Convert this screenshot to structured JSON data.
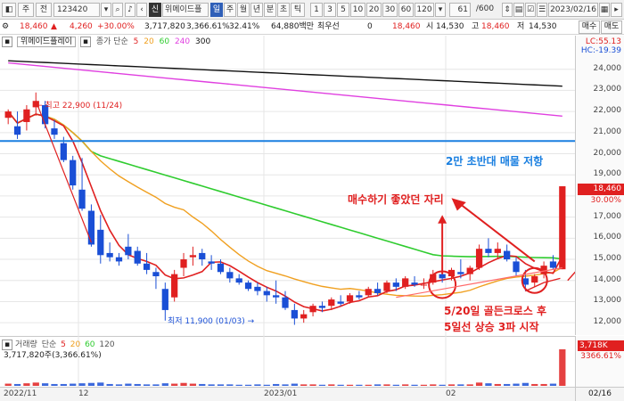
{
  "toolbar": {
    "code_label": "주",
    "prev_label": "전",
    "stock_code": "123420",
    "stock_name": "위메이드플",
    "period_tabs": [
      "일",
      "주",
      "월",
      "년",
      "분",
      "초",
      "틱"
    ],
    "interval_buttons": [
      "1",
      "3",
      "5",
      "10",
      "20",
      "30",
      "60",
      "120"
    ],
    "count_value": "61",
    "count_total": "/600",
    "date_value": "2023/02/16",
    "buy_label": "매수",
    "sell_label": "매도"
  },
  "quote": {
    "price": "18,460",
    "change": "4,260",
    "change_pct": "+30.00%",
    "volume": "3,717,820",
    "volume_ratio": "3,366.61%",
    "turnover": "32.41%",
    "amount": "64,880백만",
    "priority_label": "최우선",
    "priority_value": "0",
    "last_price": "18,460",
    "open_label": "시",
    "open_value": "14,530",
    "high_label": "고",
    "high_value": "18,460",
    "low_label": "저",
    "low_value": "14,530"
  },
  "legend": {
    "name": "위메이드플레이",
    "ma_label": "종가 단순",
    "ma_periods": [
      "5",
      "20",
      "60",
      "240",
      "300"
    ]
  },
  "colors": {
    "up": "#e02020",
    "down": "#1a4fd6",
    "ma5": "#e02020",
    "ma20": "#f0a020",
    "ma60": "#2fcc2f",
    "ma240": "#e040e0",
    "ma300": "#111111",
    "resistance": "#1a7fe0",
    "annotation": "#e02020"
  },
  "annotations": {
    "high_label": "최고 22,900 (11/24)",
    "low_label": "최저 11,900 (01/03)",
    "resistance_text": "2만 초반대 매물 저항",
    "buy_point_text": "매수하기 좋았던 자리",
    "golden_cross_line1": "5/20일 골든크로스 후",
    "golden_cross_line2": "5일선 상승 3파 시작",
    "lc_label": "LC:55.13",
    "hc_label": "HC:-19.39",
    "price_tag": "18,460",
    "pct_tag": "30.00%"
  },
  "price_axis": {
    "ticks": [
      "24,000",
      "23,000",
      "22,000",
      "21,000",
      "20,000",
      "19,000",
      "17,000",
      "16,000",
      "15,000",
      "14,000",
      "13,000",
      "12,000"
    ]
  },
  "volume_pane": {
    "title": "거래량",
    "ma_label": "단순",
    "ma_periods": [
      "5",
      "20",
      "60",
      "120"
    ],
    "volume_text": "3,717,820주(3,366.61%)",
    "axis_value": "3,718K",
    "axis_pct": "3366.61%"
  },
  "x_axis": {
    "labels": [
      "2022/11",
      "12",
      "2023/01",
      "02",
      "02/16"
    ]
  },
  "chart_data": {
    "type": "candlestick",
    "title": "위메이드플레이",
    "ylim": [
      11500,
      25000
    ],
    "candles": [
      {
        "o": 21700,
        "h": 22100,
        "l": 21400,
        "c": 22000
      },
      {
        "o": 21300,
        "h": 22000,
        "l": 20700,
        "c": 20900
      },
      {
        "o": 21500,
        "h": 22300,
        "l": 21100,
        "c": 22100
      },
      {
        "o": 22200,
        "h": 22900,
        "l": 21800,
        "c": 22500
      },
      {
        "o": 22300,
        "h": 22500,
        "l": 21200,
        "c": 21400
      },
      {
        "o": 21200,
        "h": 21600,
        "l": 20700,
        "c": 20900
      },
      {
        "o": 20500,
        "h": 20800,
        "l": 19600,
        "c": 19700
      },
      {
        "o": 19700,
        "h": 19900,
        "l": 18300,
        "c": 18500
      },
      {
        "o": 18300,
        "h": 19800,
        "l": 17300,
        "c": 17400
      },
      {
        "o": 17300,
        "h": 17600,
        "l": 15600,
        "c": 15700
      },
      {
        "o": 16400,
        "h": 17100,
        "l": 14800,
        "c": 15200
      },
      {
        "o": 15300,
        "h": 15800,
        "l": 14900,
        "c": 15100
      },
      {
        "o": 15100,
        "h": 15300,
        "l": 14700,
        "c": 14900
      },
      {
        "o": 15600,
        "h": 16200,
        "l": 15000,
        "c": 15200
      },
      {
        "o": 15400,
        "h": 15600,
        "l": 14700,
        "c": 14800
      },
      {
        "o": 14800,
        "h": 15300,
        "l": 14300,
        "c": 14500
      },
      {
        "o": 14400,
        "h": 14600,
        "l": 13600,
        "c": 14200
      },
      {
        "o": 13600,
        "h": 13900,
        "l": 12100,
        "c": 12600
      },
      {
        "o": 13200,
        "h": 14500,
        "l": 13000,
        "c": 14300
      },
      {
        "o": 14600,
        "h": 15300,
        "l": 14200,
        "c": 15000
      },
      {
        "o": 15100,
        "h": 15600,
        "l": 14700,
        "c": 15200
      },
      {
        "o": 15300,
        "h": 15500,
        "l": 14700,
        "c": 15000
      },
      {
        "o": 14900,
        "h": 15200,
        "l": 14500,
        "c": 14800
      },
      {
        "o": 14800,
        "h": 15000,
        "l": 14300,
        "c": 14400
      },
      {
        "o": 14400,
        "h": 14600,
        "l": 13900,
        "c": 14100
      },
      {
        "o": 14100,
        "h": 14300,
        "l": 13800,
        "c": 13900
      },
      {
        "o": 13900,
        "h": 14000,
        "l": 13500,
        "c": 13600
      },
      {
        "o": 13700,
        "h": 13900,
        "l": 13300,
        "c": 13500
      },
      {
        "o": 13500,
        "h": 13700,
        "l": 13000,
        "c": 13300
      },
      {
        "o": 13300,
        "h": 14000,
        "l": 12900,
        "c": 13200
      },
      {
        "o": 13200,
        "h": 13500,
        "l": 12600,
        "c": 12700
      },
      {
        "o": 12600,
        "h": 12900,
        "l": 11900,
        "c": 12200
      },
      {
        "o": 12200,
        "h": 12600,
        "l": 12000,
        "c": 12400
      },
      {
        "o": 12500,
        "h": 12900,
        "l": 12300,
        "c": 12800
      },
      {
        "o": 12800,
        "h": 13000,
        "l": 12500,
        "c": 12700
      },
      {
        "o": 12800,
        "h": 13200,
        "l": 12600,
        "c": 13100
      },
      {
        "o": 13000,
        "h": 13300,
        "l": 12800,
        "c": 12900
      },
      {
        "o": 13000,
        "h": 13400,
        "l": 12900,
        "c": 13300
      },
      {
        "o": 13300,
        "h": 13500,
        "l": 13100,
        "c": 13200
      },
      {
        "o": 13300,
        "h": 13700,
        "l": 13200,
        "c": 13600
      },
      {
        "o": 13600,
        "h": 13900,
        "l": 13300,
        "c": 13400
      },
      {
        "o": 13500,
        "h": 14000,
        "l": 13400,
        "c": 13900
      },
      {
        "o": 13900,
        "h": 14100,
        "l": 13500,
        "c": 13700
      },
      {
        "o": 13700,
        "h": 14200,
        "l": 13600,
        "c": 14100
      },
      {
        "o": 13900,
        "h": 14200,
        "l": 13700,
        "c": 13800
      },
      {
        "o": 13800,
        "h": 14100,
        "l": 13600,
        "c": 13800
      },
      {
        "o": 13900,
        "h": 14500,
        "l": 13800,
        "c": 14300
      },
      {
        "o": 14300,
        "h": 14600,
        "l": 13900,
        "c": 14100
      },
      {
        "o": 14200,
        "h": 14600,
        "l": 14000,
        "c": 14500
      },
      {
        "o": 14400,
        "h": 15000,
        "l": 14100,
        "c": 14300
      },
      {
        "o": 14300,
        "h": 14700,
        "l": 14000,
        "c": 14600
      },
      {
        "o": 14600,
        "h": 15700,
        "l": 14500,
        "c": 15500
      },
      {
        "o": 15500,
        "h": 16000,
        "l": 15100,
        "c": 15300
      },
      {
        "o": 15300,
        "h": 15800,
        "l": 15000,
        "c": 15500
      },
      {
        "o": 15400,
        "h": 15700,
        "l": 14900,
        "c": 15000
      },
      {
        "o": 14900,
        "h": 15100,
        "l": 14200,
        "c": 14400
      },
      {
        "o": 14100,
        "h": 14500,
        "l": 13500,
        "c": 13800
      },
      {
        "o": 13900,
        "h": 14300,
        "l": 13700,
        "c": 14200
      },
      {
        "o": 14300,
        "h": 14900,
        "l": 14100,
        "c": 14700
      },
      {
        "o": 14900,
        "h": 15200,
        "l": 14500,
        "c": 14600
      },
      {
        "o": 14530,
        "h": 18460,
        "l": 14530,
        "c": 18460
      }
    ],
    "volumes": [
      0.06,
      0.05,
      0.07,
      0.09,
      0.07,
      0.05,
      0.05,
      0.06,
      0.07,
      0.08,
      0.09,
      0.05,
      0.04,
      0.06,
      0.05,
      0.04,
      0.04,
      0.07,
      0.06,
      0.08,
      0.06,
      0.05,
      0.04,
      0.04,
      0.04,
      0.03,
      0.03,
      0.04,
      0.03,
      0.05,
      0.04,
      0.06,
      0.04,
      0.04,
      0.03,
      0.04,
      0.03,
      0.03,
      0.03,
      0.03,
      0.04,
      0.04,
      0.03,
      0.04,
      0.03,
      0.03,
      0.04,
      0.03,
      0.04,
      0.04,
      0.04,
      0.09,
      0.07,
      0.05,
      0.05,
      0.06,
      0.08,
      0.05,
      0.05,
      0.06,
      1.0
    ],
    "resistance_level": 20600
  }
}
